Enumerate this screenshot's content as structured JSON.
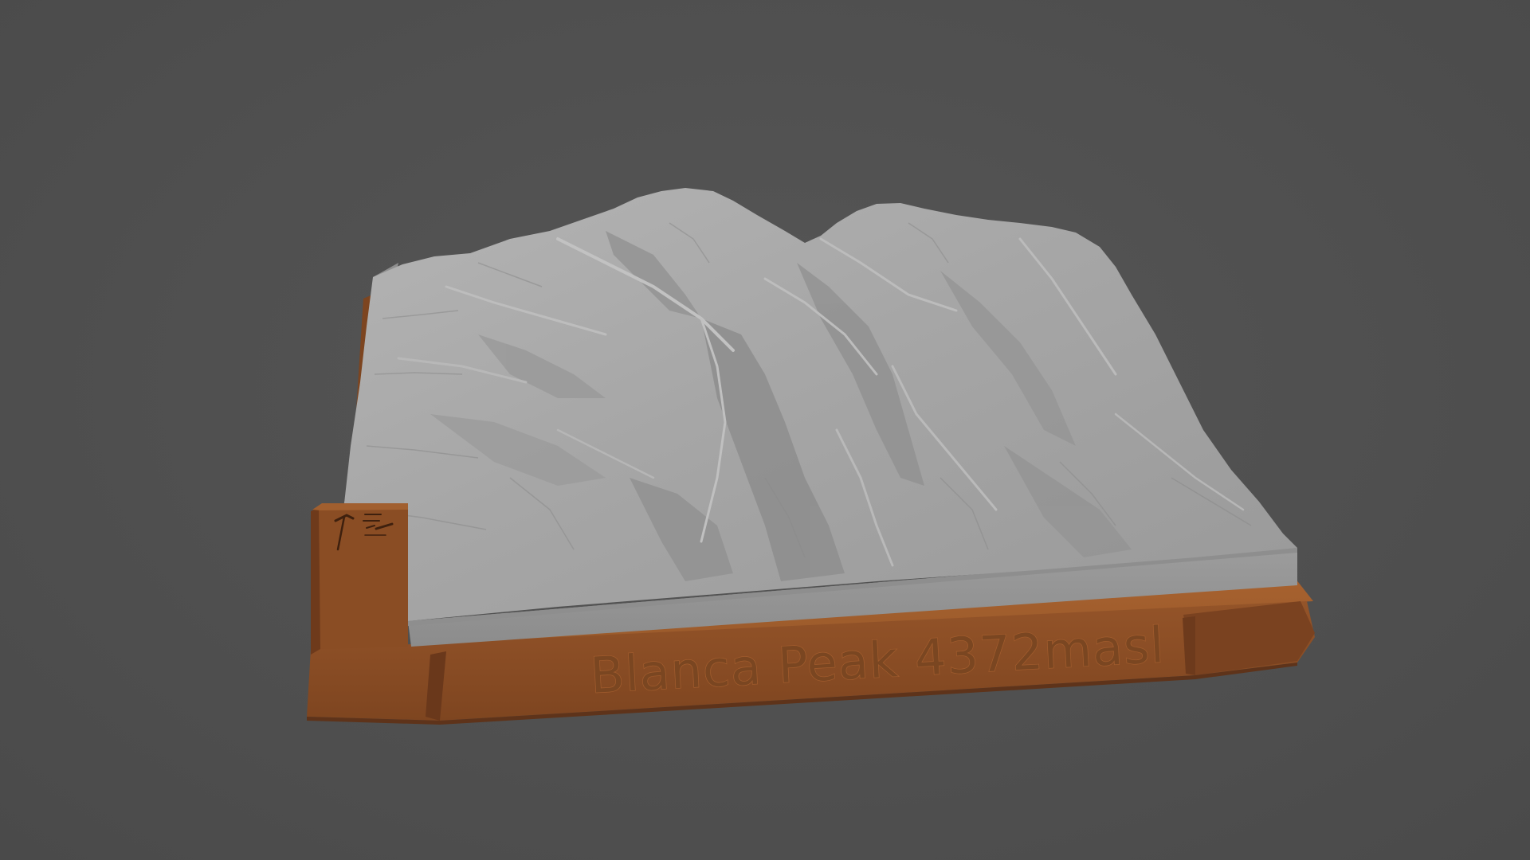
{
  "scene": {
    "background_color": "#505050",
    "model": {
      "terrain_color": "#a2a2a2",
      "base_color": "#8a4f27",
      "engraved_text": "Blanca Peak 4372masl",
      "plaque_icons": [
        "ice-axe-icon",
        "ruler-scale-icon"
      ]
    }
  }
}
